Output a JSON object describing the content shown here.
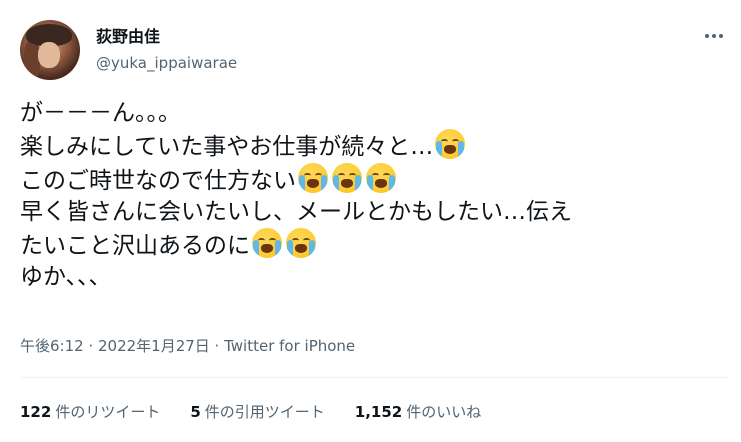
{
  "author": {
    "name": "荻野由佳",
    "handle": "@yuka_ippaiwarae"
  },
  "tweet": {
    "lines": [
      {
        "text": "が－－－ん。。。",
        "emoji_count": 0
      },
      {
        "text": "楽しみにしていた事やお仕事が続々と…",
        "emoji_count": 1
      },
      {
        "text": "このご時世なので仕方ない",
        "emoji_count": 3
      },
      {
        "text": "早く皆さんに会いたいし、メールとかもしたい…伝え",
        "emoji_count": 0
      },
      {
        "text": "たいこと沢山あるのに",
        "emoji_count": 2
      },
      {
        "text": "ゆか、、、",
        "emoji_count": 0
      }
    ],
    "emoji_icon": "loudly-crying-face-icon"
  },
  "meta": {
    "text": "午後6:12 · 2022年1月27日 · Twitter for iPhone"
  },
  "stats": [
    {
      "count": "122",
      "label": "件のリツイート"
    },
    {
      "count": "5",
      "label": "件の引用ツイート"
    },
    {
      "count": "1,152",
      "label": "件のいいね"
    }
  ],
  "colors": {
    "text": "#0f1419",
    "secondary": "#536471",
    "divider": "#eff3f4"
  }
}
